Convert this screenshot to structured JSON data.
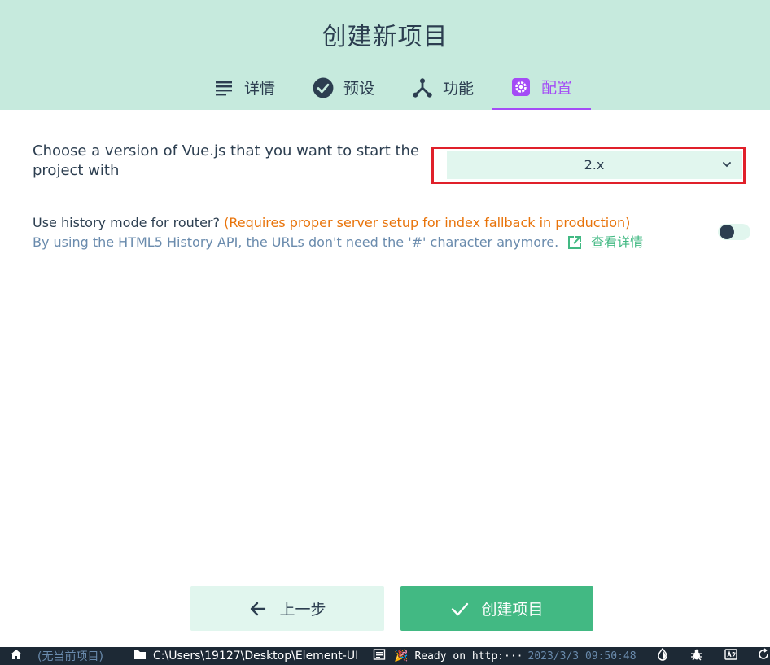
{
  "header": {
    "title": "创建新项目",
    "tabs": [
      {
        "label": "详情",
        "icon": "list-icon",
        "active": false
      },
      {
        "label": "预设",
        "icon": "check-circle-icon",
        "active": false
      },
      {
        "label": "功能",
        "icon": "fork-icon",
        "active": false
      },
      {
        "label": "配置",
        "icon": "gear-icon",
        "active": true
      }
    ]
  },
  "config": {
    "vue_version_prompt": "Choose a version of Vue.js that you want to start the project with",
    "vue_version_value": "2.x",
    "history_prompt": "Use history mode for router?",
    "history_warning": "(Requires proper server setup for index fallback in production)",
    "history_description": "By using the HTML5 History API, the URLs don't need the '#' character anymore.",
    "history_link_label": "查看详情",
    "history_enabled": false
  },
  "footer": {
    "prev_label": "上一步",
    "create_label": "创建项目"
  },
  "statusbar": {
    "project": "(无当前项目)",
    "path": "C:\\Users\\19127\\Desktop\\Element-UI",
    "log": "Ready on http:···",
    "timestamp": "2023/3/3  09:50:48"
  },
  "colors": {
    "header_bg": "#c6eadd",
    "accent_active": "#a44cf6",
    "primary": "#42b983",
    "warning": "#e8730a",
    "highlight_border": "#e0202a"
  }
}
